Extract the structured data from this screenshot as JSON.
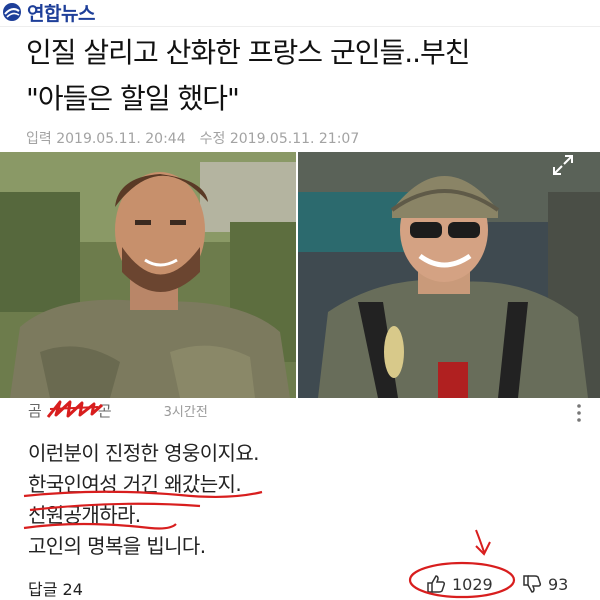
{
  "app": {
    "logo_text": "연합뉴스",
    "brand_color": "#1e3f99"
  },
  "article": {
    "headline_line1": "인질 살리고 산화한 프랑스 군인들..부친",
    "headline_line2": "\"아들은 할일 했다\"",
    "input_label": "입력",
    "input_time": "2019.05.11. 20:44",
    "edit_label": "수정",
    "edit_time": "2019.05.11. 21:07",
    "photos": [
      "soldier-photo-left",
      "soldier-photo-right"
    ]
  },
  "comment": {
    "author_visible": "곰",
    "author_tail": "곤",
    "time": "3시간전",
    "lines": [
      "이런분이 진정한 영웅이지요.",
      "한국인여성  거긴 왜갔는지.",
      "신원공개하라.",
      "고인의 명복을 빕니다."
    ]
  },
  "footer": {
    "reply_label": "답글 24",
    "like_count": "1029",
    "dislike_count": "93"
  },
  "colors": {
    "annotation_red": "#d81e1e",
    "meta_gray": "#a3a3a3"
  }
}
